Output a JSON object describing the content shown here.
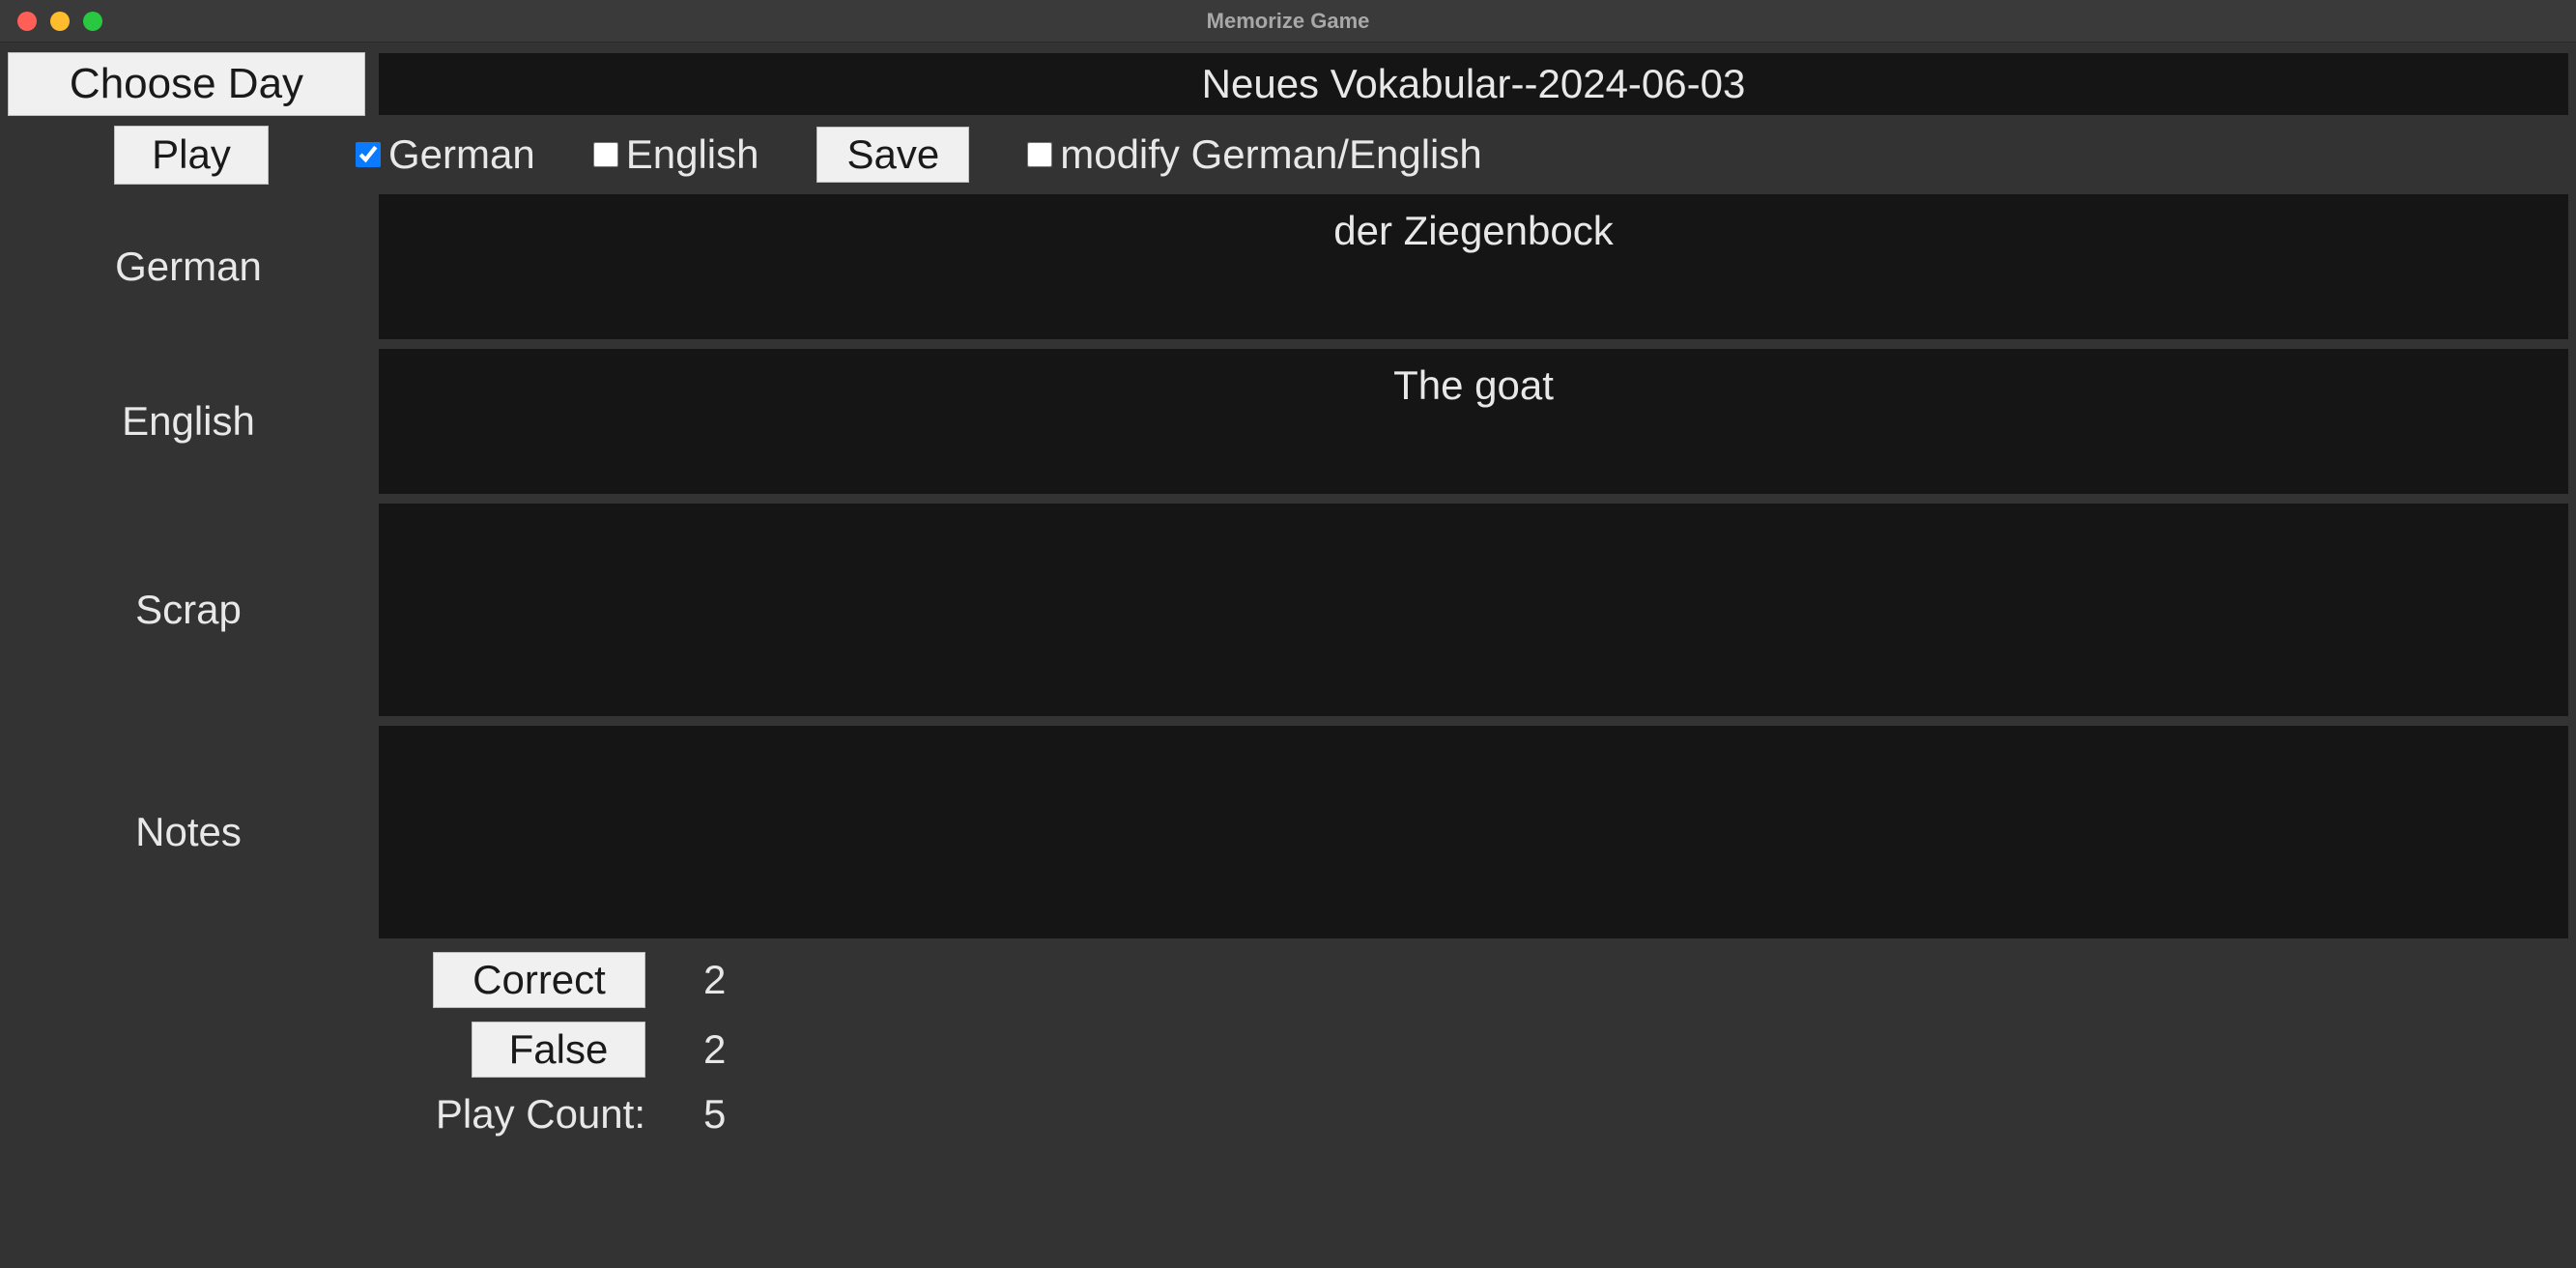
{
  "window": {
    "title": "Memorize Game"
  },
  "header": {
    "choose_day_label": "Choose Day",
    "deck_title": "Neues Vokabular--2024-06-03"
  },
  "controls": {
    "play_label": "Play",
    "german_checkbox_label": "German",
    "german_checked": true,
    "english_checkbox_label": "English",
    "english_checked": false,
    "save_label": "Save",
    "modify_checkbox_label": "modify German/English",
    "modify_checked": false
  },
  "fields": {
    "german": {
      "label": "German",
      "value": "der Ziegenbock"
    },
    "english": {
      "label": "English",
      "value": "The goat"
    },
    "scrap": {
      "label": "Scrap",
      "value": ""
    },
    "notes": {
      "label": "Notes",
      "value": ""
    }
  },
  "scores": {
    "correct_label": "Correct",
    "correct_value": "2",
    "false_label": "False",
    "false_value": "2",
    "playcount_label": "Play Count:",
    "playcount_value": "5"
  }
}
